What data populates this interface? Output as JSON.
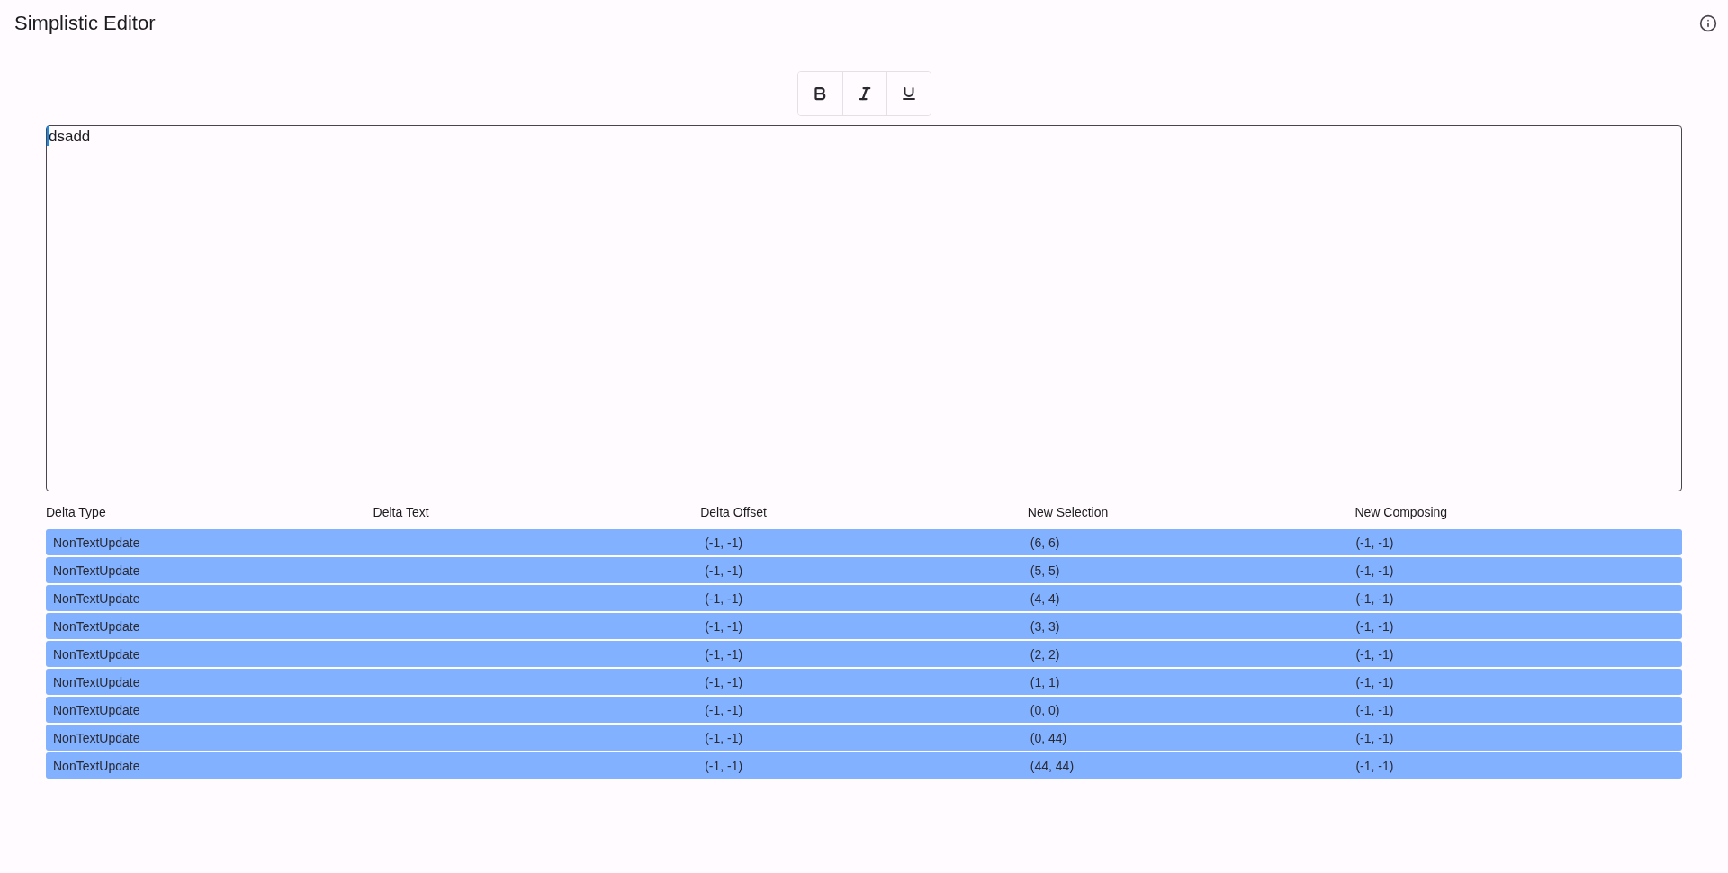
{
  "app_bar": {
    "title": "Simplistic Editor"
  },
  "toolbar": [
    {
      "kind": "bold"
    },
    {
      "kind": "italic"
    },
    {
      "kind": "underline"
    }
  ],
  "editor": {
    "value": "dsadd"
  },
  "table": {
    "columns": [
      "Delta Type",
      "Delta Text",
      "Delta Offset",
      "New Selection",
      "New Composing"
    ],
    "rows": [
      {
        "delta_type": "NonTextUpdate",
        "delta_offset": "(-1, -1)",
        "new_selection": "(6, 6)",
        "new_composing": "(-1, -1)"
      },
      {
        "delta_type": "NonTextUpdate",
        "delta_offset": "(-1, -1)",
        "new_selection": "(5, 5)",
        "new_composing": "(-1, -1)"
      },
      {
        "delta_type": "NonTextUpdate",
        "delta_offset": "(-1, -1)",
        "new_selection": "(4, 4)",
        "new_composing": "(-1, -1)"
      },
      {
        "delta_type": "NonTextUpdate",
        "delta_offset": "(-1, -1)",
        "new_selection": "(3, 3)",
        "new_composing": "(-1, -1)"
      },
      {
        "delta_type": "NonTextUpdate",
        "delta_offset": "(-1, -1)",
        "new_selection": "(2, 2)",
        "new_composing": "(-1, -1)"
      },
      {
        "delta_type": "NonTextUpdate",
        "delta_offset": "(-1, -1)",
        "new_selection": "(1, 1)",
        "new_composing": "(-1, -1)"
      },
      {
        "delta_type": "NonTextUpdate",
        "delta_offset": "(-1, -1)",
        "new_selection": "(0, 0)",
        "new_composing": "(-1, -1)"
      },
      {
        "delta_type": "NonTextUpdate",
        "delta_offset": "(-1, -1)",
        "new_selection": "(0, 44)",
        "new_composing": "(-1, -1)"
      },
      {
        "delta_type": "NonTextUpdate",
        "delta_offset": "(-1, -1)",
        "new_selection": "(44, 44)",
        "new_composing": "(-1, -1)"
      }
    ]
  }
}
